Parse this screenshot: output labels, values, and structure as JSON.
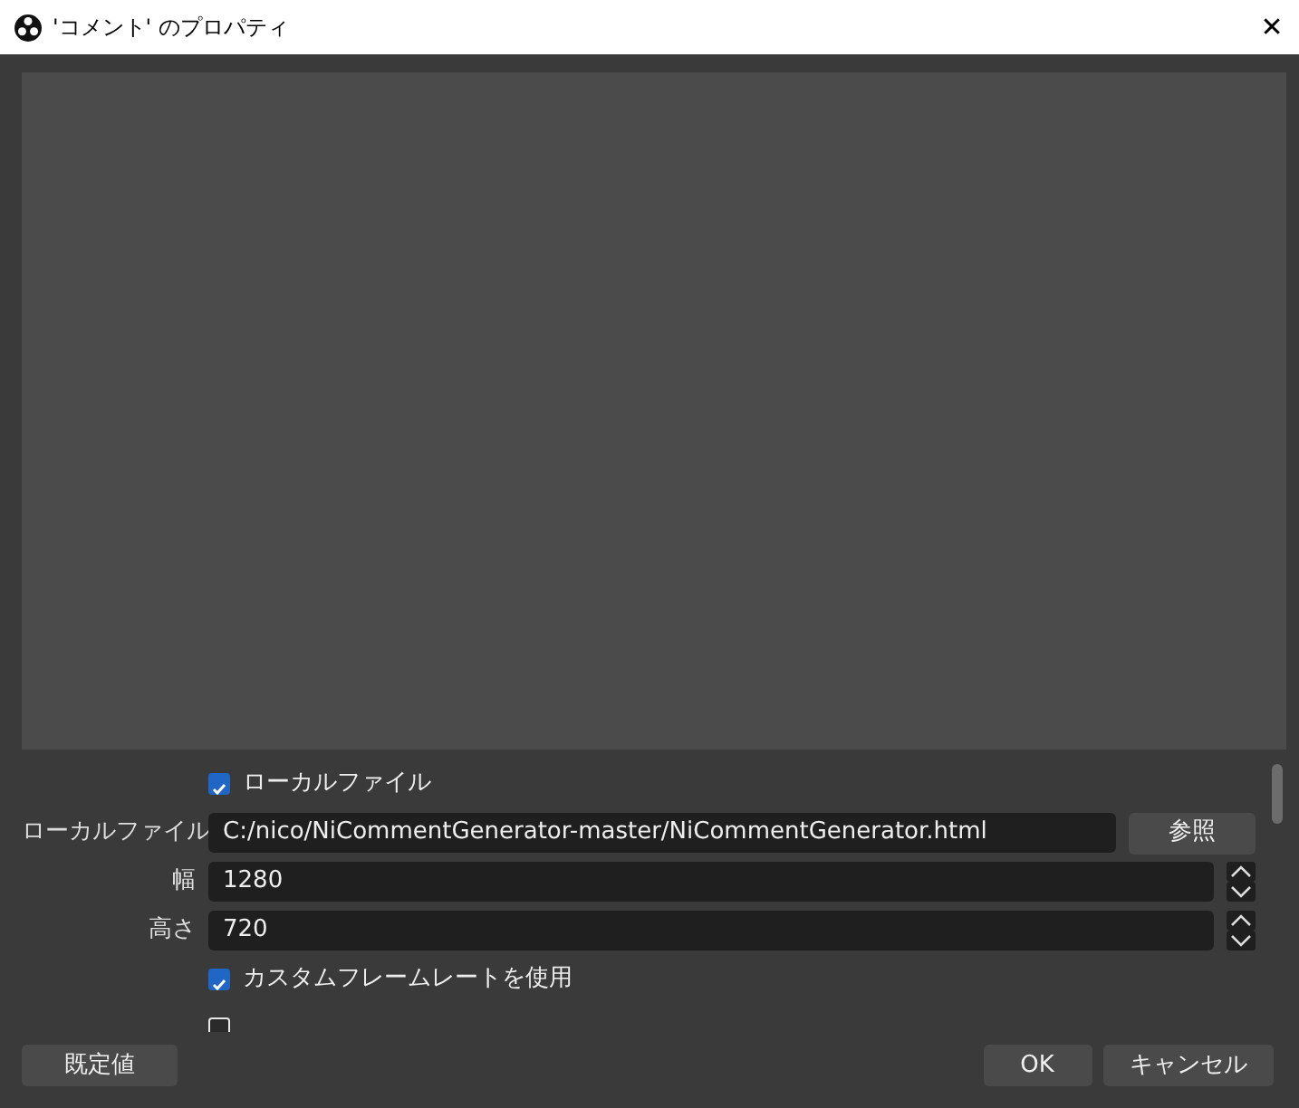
{
  "window": {
    "title": "'コメント' のプロパティ",
    "close": "✕"
  },
  "properties": [
    {
      "kind": "checkbox",
      "label": "ローカルファイル",
      "checked": true
    },
    {
      "kind": "file",
      "label": "ローカルファイル",
      "value": "C:/nico/NiCommentGenerator-master/NiCommentGenerator.html",
      "button": "参照"
    },
    {
      "kind": "spin",
      "label": "幅",
      "value": "1280"
    },
    {
      "kind": "spin",
      "label": "高さ",
      "value": "720"
    },
    {
      "kind": "checkbox",
      "label": "カスタムフレームレートを使用",
      "checked": true
    },
    {
      "kind": "checkbox",
      "checked": false
    }
  ],
  "buttons": {
    "defaults": "既定値",
    "ok": "OK",
    "cancel": "キャンセル"
  }
}
